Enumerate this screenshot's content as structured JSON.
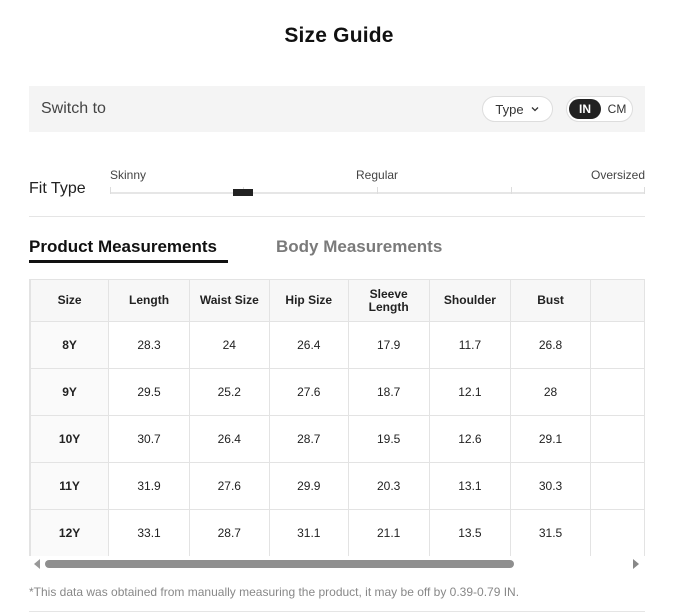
{
  "page": {
    "title": "Size Guide"
  },
  "switch_bar": {
    "label": "Switch to",
    "type_label": "Type",
    "units": [
      "IN",
      "CM"
    ],
    "selected_unit": "IN"
  },
  "fit_type": {
    "label": "Fit Type",
    "scale": [
      "Skinny",
      "Regular",
      "Oversized"
    ]
  },
  "tabs": [
    {
      "label": "Product Measurements",
      "active": true
    },
    {
      "label": "Body Measurements",
      "active": false
    }
  ],
  "table": {
    "headers": [
      "Size",
      "Length",
      "Waist Size",
      "Hip Size",
      "Sleeve Length",
      "Shoulder",
      "Bust",
      ""
    ],
    "rows": [
      [
        "8Y",
        "28.3",
        "24",
        "26.4",
        "17.9",
        "11.7",
        "26.8",
        ""
      ],
      [
        "9Y",
        "29.5",
        "25.2",
        "27.6",
        "18.7",
        "12.1",
        "28",
        ""
      ],
      [
        "10Y",
        "30.7",
        "26.4",
        "28.7",
        "19.5",
        "12.6",
        "29.1",
        ""
      ],
      [
        "11Y",
        "31.9",
        "27.6",
        "29.9",
        "20.3",
        "13.1",
        "30.3",
        ""
      ],
      [
        "12Y",
        "33.1",
        "28.7",
        "31.1",
        "21.1",
        "13.5",
        "31.5",
        ""
      ]
    ]
  },
  "footnote": "*This data was obtained from manually measuring the product, it may be off by 0.39-0.79 IN."
}
